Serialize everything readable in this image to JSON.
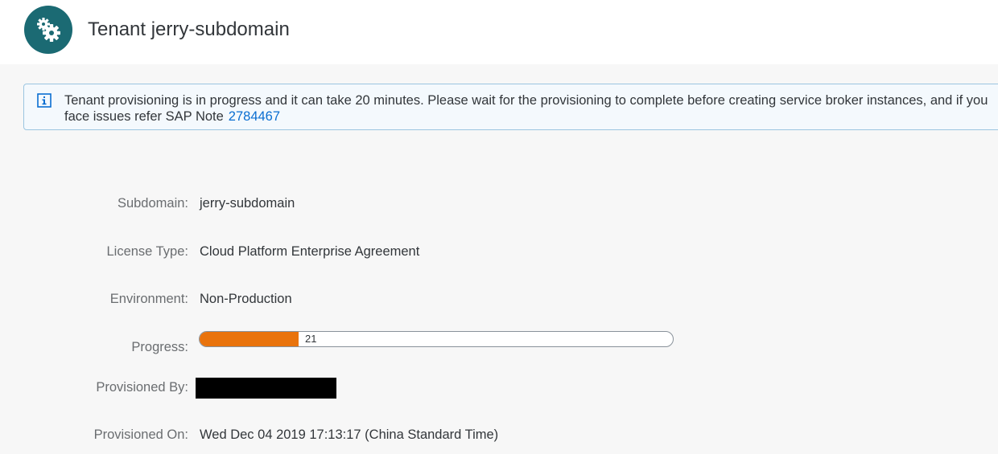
{
  "header": {
    "title": "Tenant jerry-subdomain",
    "icon": "gears-icon",
    "avatar_color": "#1b6a73"
  },
  "info_strip": {
    "message": "Tenant provisioning is in progress and it can take 20 minutes. Please wait for the provisioning to complete before creating service broker instances, and if you face issues refer SAP Note",
    "link_text": "2784467",
    "icon": "info-icon",
    "link_color": "#0a6ed1"
  },
  "fields": {
    "subdomain": {
      "label": "Subdomain:",
      "value": "jerry-subdomain"
    },
    "license_type": {
      "label": "License Type:",
      "value": "Cloud Platform Enterprise Agreement"
    },
    "environment": {
      "label": "Environment:",
      "value": "Non-Production"
    },
    "progress": {
      "label": "Progress:",
      "value": 21,
      "display": "21",
      "color": "#e9730c"
    },
    "provisioned_by": {
      "label": "Provisioned By:",
      "value_redacted": true
    },
    "provisioned_on": {
      "label": "Provisioned On:",
      "value": "Wed Dec 04 2019 17:13:17 (China Standard Time)"
    }
  }
}
